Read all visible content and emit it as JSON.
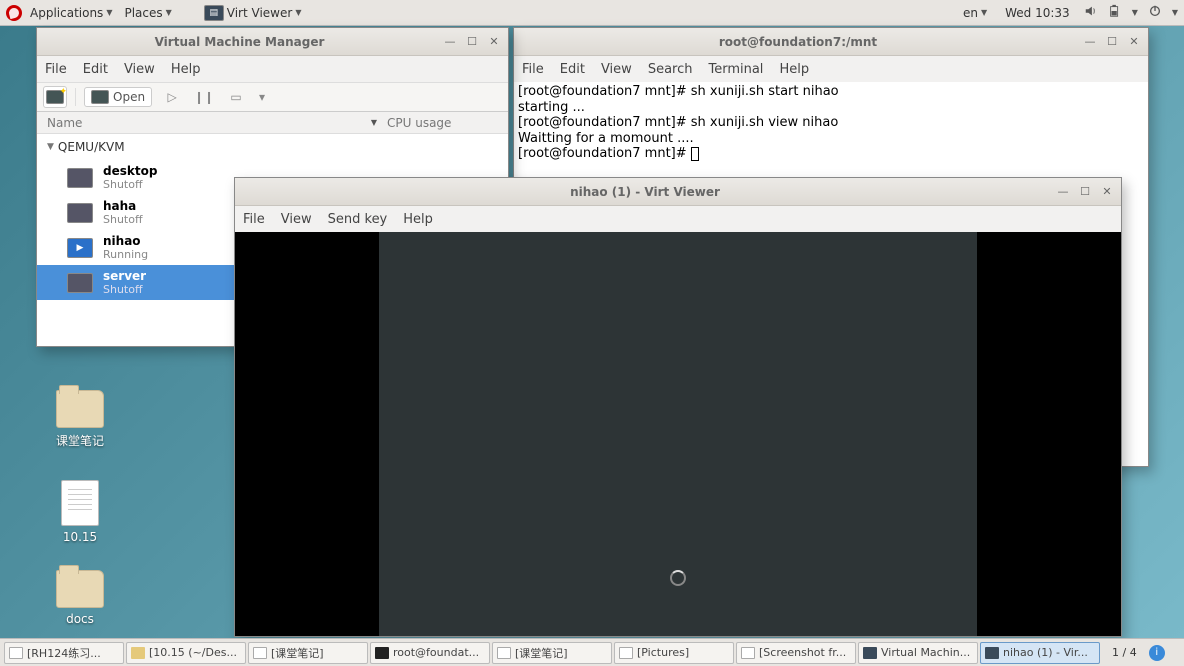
{
  "panel": {
    "applications": "Applications",
    "places": "Places",
    "active_app": "Virt Viewer",
    "lang": "en",
    "clock": "Wed 10:33"
  },
  "desktop": {
    "icon1": "课堂笔记",
    "icon2": "10.15",
    "icon3": "docs"
  },
  "vmm": {
    "title": "Virtual Machine Manager",
    "menu": {
      "file": "File",
      "edit": "Edit",
      "view": "View",
      "help": "Help"
    },
    "toolbar": {
      "open": "Open"
    },
    "headers": {
      "name": "Name",
      "cpu": "CPU usage"
    },
    "group": "QEMU/KVM",
    "vms": [
      {
        "name": "desktop",
        "status": "Shutoff"
      },
      {
        "name": "haha",
        "status": "Shutoff"
      },
      {
        "name": "nihao",
        "status": "Running"
      },
      {
        "name": "server",
        "status": "Shutoff"
      }
    ]
  },
  "terminal": {
    "title": "root@foundation7:/mnt",
    "menu": {
      "file": "File",
      "edit": "Edit",
      "view": "View",
      "search": "Search",
      "terminal": "Terminal",
      "help": "Help"
    },
    "lines": [
      "[root@foundation7 mnt]# sh xuniji.sh start nihao",
      "starting ...",
      "[root@foundation7 mnt]# sh xuniji.sh view nihao",
      "Waitting for a momount ....",
      "[root@foundation7 mnt]# "
    ]
  },
  "viewer": {
    "title": "nihao (1) - Virt Viewer",
    "menu": {
      "file": "File",
      "view": "View",
      "sendkey": "Send key",
      "help": "Help"
    }
  },
  "taskbar": {
    "items": [
      "[RH124练习...",
      "[10.15 (~/Des...",
      "[课堂笔记]",
      "root@foundat...",
      "[课堂笔记]",
      "[Pictures]",
      "[Screenshot fr...",
      "Virtual Machin...",
      "nihao (1) - Vir..."
    ],
    "workspace": "1 / 4"
  }
}
